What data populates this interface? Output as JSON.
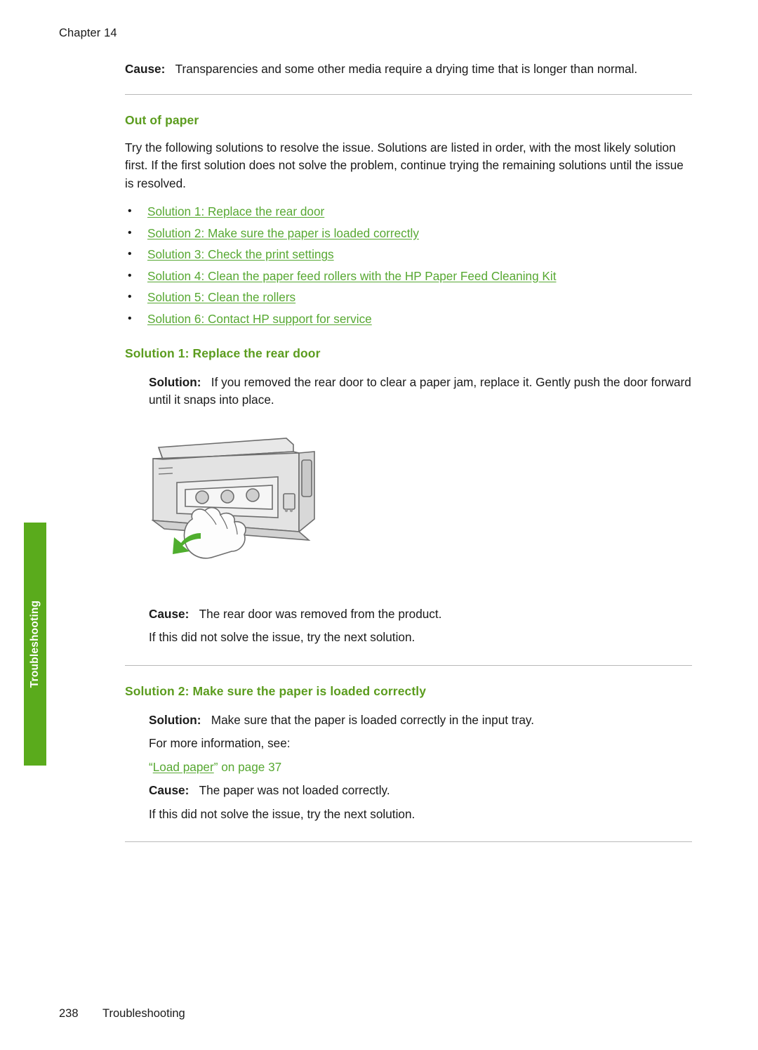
{
  "header": {
    "chapter": "Chapter 14"
  },
  "intro_cause": {
    "label": "Cause:",
    "text": "Transparencies and some other media require a drying time that is longer than normal."
  },
  "section": {
    "title": "Out of paper",
    "intro": "Try the following solutions to resolve the issue. Solutions are listed in order, with the most likely solution first. If the first solution does not solve the problem, continue trying the remaining solutions until the issue is resolved.",
    "links": [
      "Solution 1: Replace the rear door",
      "Solution 2: Make sure the paper is loaded correctly",
      "Solution 3: Check the print settings",
      "Solution 4: Clean the paper feed rollers with the HP Paper Feed Cleaning Kit",
      "Solution 5: Clean the rollers",
      "Solution 6: Contact HP support for service"
    ]
  },
  "solution1": {
    "heading": "Solution 1: Replace the rear door",
    "solution_label": "Solution:",
    "solution_text": "If you removed the rear door to clear a paper jam, replace it. Gently push the door forward until it snaps into place.",
    "cause_label": "Cause:",
    "cause_text": "The rear door was removed from the product.",
    "next": "If this did not solve the issue, try the next solution."
  },
  "solution2": {
    "heading": "Solution 2: Make sure the paper is loaded correctly",
    "solution_label": "Solution:",
    "solution_text": "Make sure that the paper is loaded correctly in the input tray.",
    "more_info": "For more information, see:",
    "ref_open_quote": "“",
    "ref_link": "Load paper",
    "ref_close": "” on page 37",
    "cause_label": "Cause:",
    "cause_text": "The paper was not loaded correctly.",
    "next": "If this did not solve the issue, try the next solution."
  },
  "side_tab": {
    "label": "Troubleshooting",
    "color": "#5aab1c"
  },
  "footer": {
    "page_number": "238",
    "section_name": "Troubleshooting"
  },
  "figure": {
    "alt": "printer-rear-door-illustration"
  }
}
